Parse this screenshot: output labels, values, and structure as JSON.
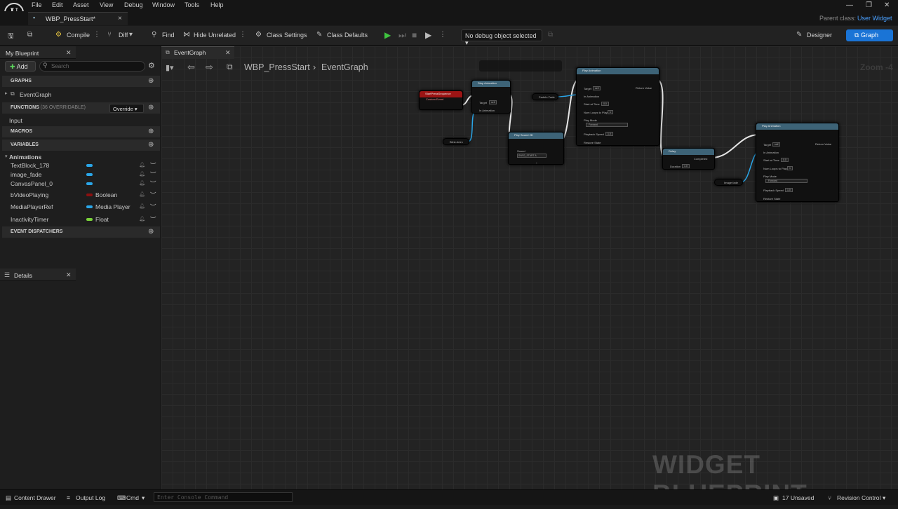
{
  "app": {
    "logo": "U"
  },
  "menu": [
    "File",
    "Edit",
    "Asset",
    "View",
    "Debug",
    "Window",
    "Tools",
    "Help"
  ],
  "tab": {
    "title": "WBP_PressStart*",
    "close": "×"
  },
  "parent_class": {
    "label": "Parent class:",
    "value": "User Widget"
  },
  "toolbar": {
    "compile": "Compile",
    "diff": "Diff",
    "find": "Find",
    "hide_unrelated": "Hide Unrelated",
    "class_settings": "Class Settings",
    "class_defaults": "Class Defaults",
    "debug_object": "No debug object selected",
    "designer": "Designer",
    "graph": "Graph"
  },
  "my_blueprint": {
    "tab": "My Blueprint",
    "add": "Add",
    "search_placeholder": "Search",
    "graphs_header": "GRAPHS",
    "graphs": [
      "EventGraph"
    ],
    "functions_header": "FUNCTIONS",
    "functions_count": "(36 OVERRIDABLE)",
    "override": "Override",
    "functions": [
      "Input"
    ],
    "macros_header": "MACROS",
    "variables_header": "VARIABLES",
    "variable_category": "Animations",
    "variables": [
      {
        "name": "TextBlock_178",
        "type": "",
        "color": "#2aa6e8"
      },
      {
        "name": "image_fade",
        "type": "",
        "color": "#2aa6e8"
      },
      {
        "name": "CanvasPanel_0",
        "type": "",
        "color": "#2aa6e8"
      },
      {
        "name": "bVideoPlaying",
        "type": "Boolean",
        "color": "#8c1010"
      },
      {
        "name": "MediaPlayerRef",
        "type": "Media Player",
        "color": "#2aa6e8"
      },
      {
        "name": "InactivityTimer",
        "type": "Float",
        "color": "#7ad23a"
      }
    ],
    "dispatchers_header": "EVENT DISPATCHERS"
  },
  "details": {
    "tab": "Details"
  },
  "graph": {
    "tab": "EventGraph",
    "breadcrumb_root": "WBP_PressStart",
    "breadcrumb_leaf": "EventGraph",
    "zoom": "Zoom -4",
    "watermark": "WIDGET BLUEPRINT"
  },
  "nodes": {
    "event": {
      "title": "StartPressSequence",
      "sub": "Custom Event"
    },
    "stop_anim": {
      "title": "Stop Animation",
      "target": "Target",
      "target_val": "self",
      "in_anim": "In Animation"
    },
    "fade_anim": {
      "label": "Blink Anim"
    },
    "play_sound": {
      "title": "Play Sound 2D",
      "sound": "Sound",
      "sound_val": "SW32_START A"
    },
    "fade_in": {
      "label": "FadeIn Fade"
    },
    "play_anim1": {
      "title": "Play Animation",
      "target": "Target",
      "target_val": "self",
      "in_anim": "In Animation",
      "start": "Start at Time",
      "start_val": "0.0",
      "loops": "Num Loops to Play",
      "loops_val": "1",
      "mode": "Play Mode",
      "mode_val": "Forward",
      "speed": "Playback Speed",
      "speed_val": "1.0",
      "restore": "Restore State",
      "ret": "Return Value"
    },
    "delay": {
      "title": "Delay",
      "duration": "Duration",
      "duration_val": "1.0",
      "completed": "Completed"
    },
    "image_fade": {
      "label": "Image fade"
    },
    "play_anim2": {
      "title": "Play Animation",
      "target": "Target",
      "target_val": "self",
      "in_anim": "In Animation",
      "start": "Start at Time",
      "start_val": "0.0",
      "loops": "Num Loops to Play",
      "loops_val": "1",
      "mode": "Play Mode",
      "mode_val": "Forward",
      "speed": "Playback Speed",
      "speed_val": "1.0",
      "restore": "Restore State",
      "ret": "Return Value"
    }
  },
  "statusbar": {
    "content_drawer": "Content Drawer",
    "output_log": "Output Log",
    "cmd": "Cmd",
    "console_placeholder": "Enter Console Command",
    "unsaved": "17 Unsaved",
    "revision_control": "Revision Control"
  }
}
